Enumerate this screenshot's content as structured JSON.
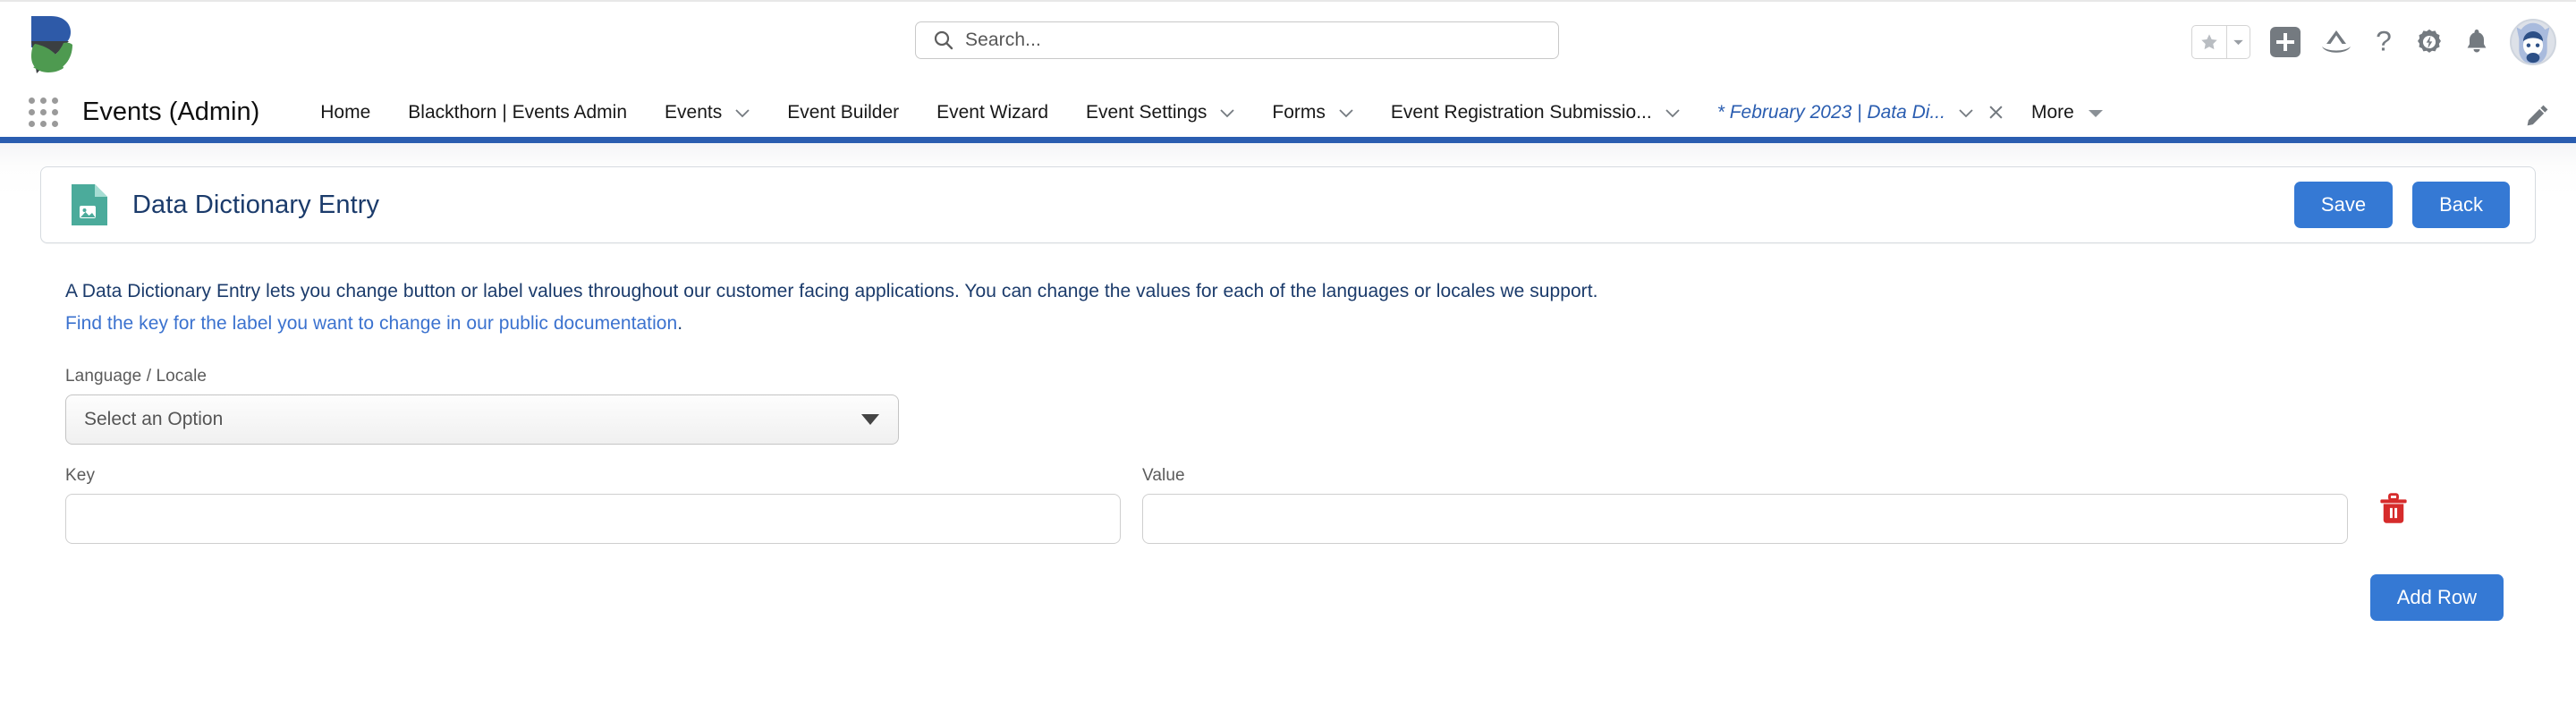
{
  "brand": {
    "logo_name": "blackthorn-logo",
    "blue": "#2e5aa8",
    "green": "#4e9a50",
    "dark": "#3b3f42"
  },
  "header": {
    "search": {
      "placeholder": "Search...",
      "value": "",
      "icon": "search-icon"
    },
    "icons": [
      {
        "name": "favorites-star-icon",
        "glyph": "★"
      },
      {
        "name": "favorites-dropdown-icon",
        "glyph": "▼"
      },
      {
        "name": "global-actions-plus-icon",
        "glyph": "+"
      },
      {
        "name": "trailhead-icon",
        "glyph": "⛰"
      },
      {
        "name": "help-icon",
        "glyph": "?"
      },
      {
        "name": "setup-gear-icon",
        "glyph": "⚙"
      },
      {
        "name": "notifications-bell-icon",
        "glyph": "🔔"
      },
      {
        "name": "user-avatar",
        "glyph": ""
      }
    ]
  },
  "nav": {
    "app_launcher_label": "App Launcher",
    "app_name": "Events (Admin)",
    "items": [
      {
        "label": "Home",
        "has_dropdown": false,
        "active": false,
        "closable": false
      },
      {
        "label": "Blackthorn | Events Admin",
        "has_dropdown": false,
        "active": false,
        "closable": false
      },
      {
        "label": "Events",
        "has_dropdown": true,
        "active": false,
        "closable": false
      },
      {
        "label": "Event Builder",
        "has_dropdown": false,
        "active": false,
        "closable": false
      },
      {
        "label": "Event Wizard",
        "has_dropdown": false,
        "active": false,
        "closable": false
      },
      {
        "label": "Event Settings",
        "has_dropdown": true,
        "active": false,
        "closable": false
      },
      {
        "label": "Forms",
        "has_dropdown": true,
        "active": false,
        "closable": false
      },
      {
        "label": "Event Registration Submissio...",
        "has_dropdown": true,
        "active": false,
        "closable": false
      },
      {
        "label": "* February 2023 | Data Di...",
        "has_dropdown": true,
        "active": true,
        "closable": true
      }
    ],
    "more_label": "More",
    "edit_icon": "pencil-icon",
    "accent_color": "#2a5db0"
  },
  "card": {
    "icon": "data-dictionary-entry-icon",
    "icon_color": "#4bab9b",
    "title": "Data Dictionary Entry",
    "save_label": "Save",
    "back_label": "Back",
    "button_color": "#3579d4"
  },
  "intro": {
    "line1": "A Data Dictionary Entry lets you change button or label values throughout our customer facing applications. You can change the values for each of the languages or locales we support.",
    "link_text": "Find the key for the label you want to change in our public documentation",
    "link_suffix": ".",
    "text_color": "#1b3b6b",
    "link_color": "#3b72cf"
  },
  "form": {
    "language_label": "Language / Locale",
    "language_value": "Select an Option",
    "language_options": [
      "Select an Option"
    ],
    "key_label": "Key",
    "value_label": "Value",
    "rows": [
      {
        "key": "",
        "value": "",
        "key_placeholder": "",
        "value_placeholder": ""
      }
    ],
    "delete_icon": "trash-icon",
    "delete_color": "#d62b2b",
    "add_row_label": "Add Row"
  }
}
